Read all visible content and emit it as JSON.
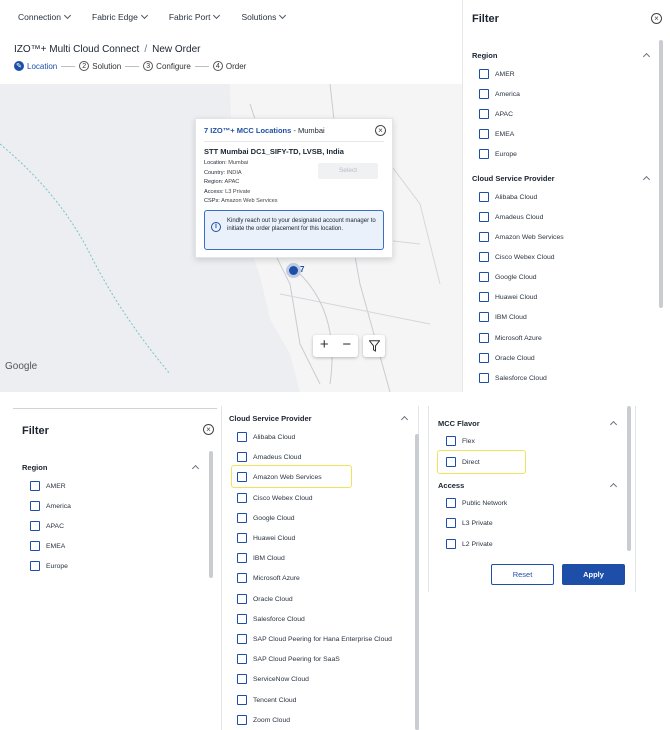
{
  "nav": {
    "items": [
      "Connection",
      "Fabric Edge",
      "Fabric Port",
      "Solutions"
    ]
  },
  "header": {
    "breadcrumb_app": "IZO™+ Multi Cloud Connect",
    "breadcrumb_sep": "/",
    "breadcrumb_page": "New Order",
    "steps": [
      {
        "num": "1",
        "label": "Location"
      },
      {
        "num": "2",
        "label": "Solution"
      },
      {
        "num": "3",
        "label": "Configure"
      },
      {
        "num": "4",
        "label": "Order"
      }
    ]
  },
  "popup": {
    "count": "7 IZO™+ MCC Locations",
    "dash": " - ",
    "city": "Mumbai",
    "site_name": "STT Mumbai DC1_SIFY-TD, LVSB, India",
    "location_label": "Location:",
    "location_value": "Mumbai",
    "country_label": "Country:",
    "country_value": "INDIA",
    "region_label": "Region:",
    "region_value": "APAC",
    "access_label": "Access:",
    "access_value": "L3 Private",
    "csps_label": "CSPs:",
    "csps_value": "Amazon Web Services",
    "select_label": "Select",
    "info_text": "Kindly reach out to your designated account manager to initiate the order placement for this location."
  },
  "map": {
    "pin_count": "7",
    "zoom_in": "+",
    "zoom_out": "−",
    "attribution": "Google"
  },
  "filter": {
    "title": "Filter",
    "region_heading": "Region",
    "regions": [
      "AMER",
      "America",
      "APAC",
      "EMEA",
      "Europe"
    ],
    "csp_heading": "Cloud Service Provider",
    "csps_top": [
      "Alibaba Cloud",
      "Amadeus Cloud",
      "Amazon Web Services",
      "Cisco Webex Cloud",
      "Google Cloud",
      "Huawei Cloud",
      "IBM Cloud",
      "Microsoft Azure",
      "Oracle Cloud",
      "Salesforce Cloud"
    ],
    "csps_full": [
      "Alibaba Cloud",
      "Amadeus Cloud",
      "Amazon Web Services",
      "Cisco Webex Cloud",
      "Google Cloud",
      "Huawei Cloud",
      "IBM Cloud",
      "Microsoft Azure",
      "Oracle Cloud",
      "Salesforce Cloud",
      "SAP Cloud Peering for Hana Enterprise Cloud",
      "SAP Cloud Peering for SaaS",
      "ServiceNow Cloud",
      "Tencent Cloud",
      "Zoom Cloud"
    ],
    "mcc_heading": "MCC Flavor",
    "mcc_flavors": [
      "Flex",
      "Direct"
    ],
    "access_heading": "Access",
    "access_options": [
      "Public Network",
      "L3 Private",
      "L2 Private"
    ],
    "reset_label": "Reset",
    "apply_label": "Apply"
  },
  "colors": {
    "accent": "#1e4fa8",
    "highlight": "#f0e25b"
  }
}
